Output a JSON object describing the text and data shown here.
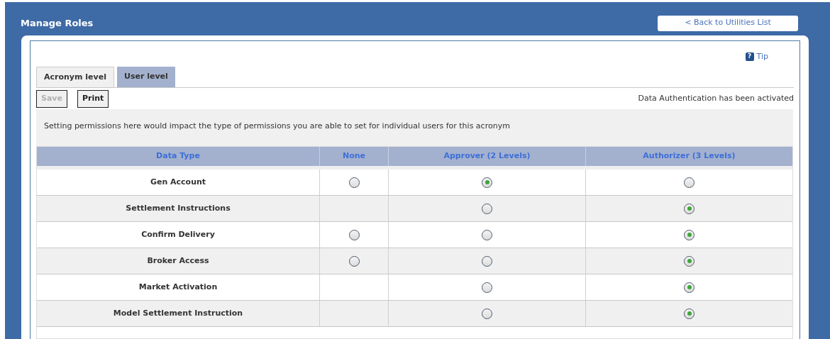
{
  "header": {
    "title": "Manage Roles",
    "back_link": "< Back to Utilities List"
  },
  "tip_icon": "?",
  "tip": "Tip",
  "tabs": [
    {
      "label": "Acronym level",
      "selected": true
    },
    {
      "label": "User level",
      "selected": false
    }
  ],
  "toolbar": {
    "buttons": [
      {
        "label": "Save",
        "disabled": true
      },
      {
        "label": "Print",
        "disabled": false
      }
    ],
    "status": "Data Authentication has been activated"
  },
  "info": "Setting permissions here would impact the type of permissions you are able to set for individual users for this acronym",
  "table": {
    "columns": [
      "Data Type",
      "None",
      "Approver (2 Levels)",
      "Authorizer (3 Levels)"
    ],
    "rows": [
      {
        "name": "Gen Account",
        "cells": [
          {
            "kind": "radio",
            "selected": false
          },
          {
            "kind": "radio",
            "selected": true
          },
          {
            "kind": "radio",
            "selected": false
          }
        ]
      },
      {
        "name": "Settlement Instructions",
        "cells": [
          {
            "kind": "empty"
          },
          {
            "kind": "radio",
            "selected": false
          },
          {
            "kind": "radio",
            "selected": true
          }
        ]
      },
      {
        "name": "Confirm Delivery",
        "cells": [
          {
            "kind": "radio",
            "selected": false
          },
          {
            "kind": "radio",
            "selected": false
          },
          {
            "kind": "radio",
            "selected": true
          }
        ]
      },
      {
        "name": "Broker Access",
        "cells": [
          {
            "kind": "radio",
            "selected": false
          },
          {
            "kind": "radio",
            "selected": false
          },
          {
            "kind": "radio",
            "selected": true
          }
        ]
      },
      {
        "name": "Market Activation",
        "cells": [
          {
            "kind": "empty"
          },
          {
            "kind": "radio",
            "selected": false
          },
          {
            "kind": "radio",
            "selected": true
          }
        ]
      },
      {
        "name": "Model Settlement Instruction",
        "cells": [
          {
            "kind": "empty"
          },
          {
            "kind": "radio",
            "selected": false
          },
          {
            "kind": "radio",
            "selected": true
          }
        ]
      }
    ]
  }
}
